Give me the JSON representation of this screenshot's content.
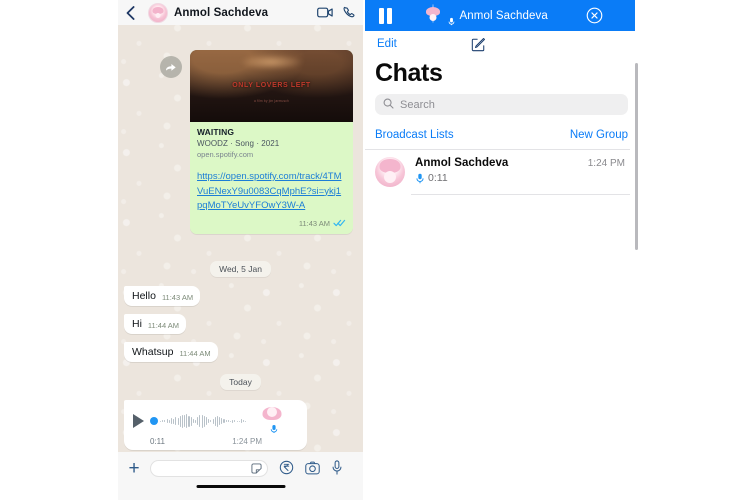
{
  "chat_thread": {
    "header": {
      "back_icon": "chevron-left-icon",
      "avatar": "contact-avatar",
      "title": "Anmol Sachdeva",
      "video_call_icon": "video-camera-icon",
      "voice_call_icon": "phone-icon"
    },
    "link_message": {
      "forward_icon": "forward-arrow-icon",
      "album_title": "ONLY LOVERS LEFT",
      "album_subtitle": "a film by jim jarmusch",
      "preview_title": "WAITING",
      "preview_subtitle": "WOODZ · Song · 2021",
      "preview_domain": "open.spotify.com",
      "link_text": "https://open.spotify.com/track/4TMVuENexY9u0083CqMphE?si=ykj1pqMoTYeUvYFOwY3W-A",
      "time": "11:43 AM",
      "ticks": "read",
      "bubble_color": "#dcf8c6"
    },
    "date_divider_1": "Wed, 5 Jan",
    "messages": [
      {
        "text": "Hello",
        "time": "11:43 AM",
        "direction": "in"
      },
      {
        "text": "Hi",
        "time": "11:44 AM",
        "direction": "in"
      },
      {
        "text": "Whatsup",
        "time": "11:44 AM",
        "direction": "in"
      }
    ],
    "date_divider_2": "Today",
    "voice_note": {
      "play_icon": "play-icon",
      "duration": "0:11",
      "time": "1:24 PM",
      "avatar": "contact-avatar",
      "mic_badge_icon": "microphone-icon"
    },
    "input_bar": {
      "plus_icon": "plus-icon",
      "message_value": "",
      "message_placeholder": "",
      "sticker_icon": "sticker-icon",
      "payments_icon": "rupee-icon",
      "camera_icon": "camera-icon",
      "mic_icon": "microphone-icon"
    }
  },
  "chat_list": {
    "playback_bar": {
      "pause_icon": "pause-icon",
      "avatar": "contact-avatar",
      "mic_badge_icon": "microphone-icon",
      "title": "Anmol Sachdeva",
      "close_icon": "close-circle-icon",
      "background_color": "#0a7cf7"
    },
    "edit_label": "Edit",
    "compose_icon": "compose-icon",
    "page_title": "Chats",
    "search": {
      "icon": "search-icon",
      "value": "",
      "placeholder": "Search"
    },
    "broadcast_lists_label": "Broadcast Lists",
    "new_group_label": "New Group",
    "items": [
      {
        "avatar": "contact-avatar",
        "name": "Anmol Sachdeva",
        "time": "1:24 PM",
        "preview_icon": "microphone-icon",
        "preview_text": "0:11"
      }
    ]
  },
  "colors": {
    "accent_blue": "#0a7cf7",
    "link_blue": "#1c7ed6",
    "outgoing_bubble": "#dcf8c6",
    "wallpaper": "#ece5dd",
    "tick_blue": "#34b7f1"
  }
}
